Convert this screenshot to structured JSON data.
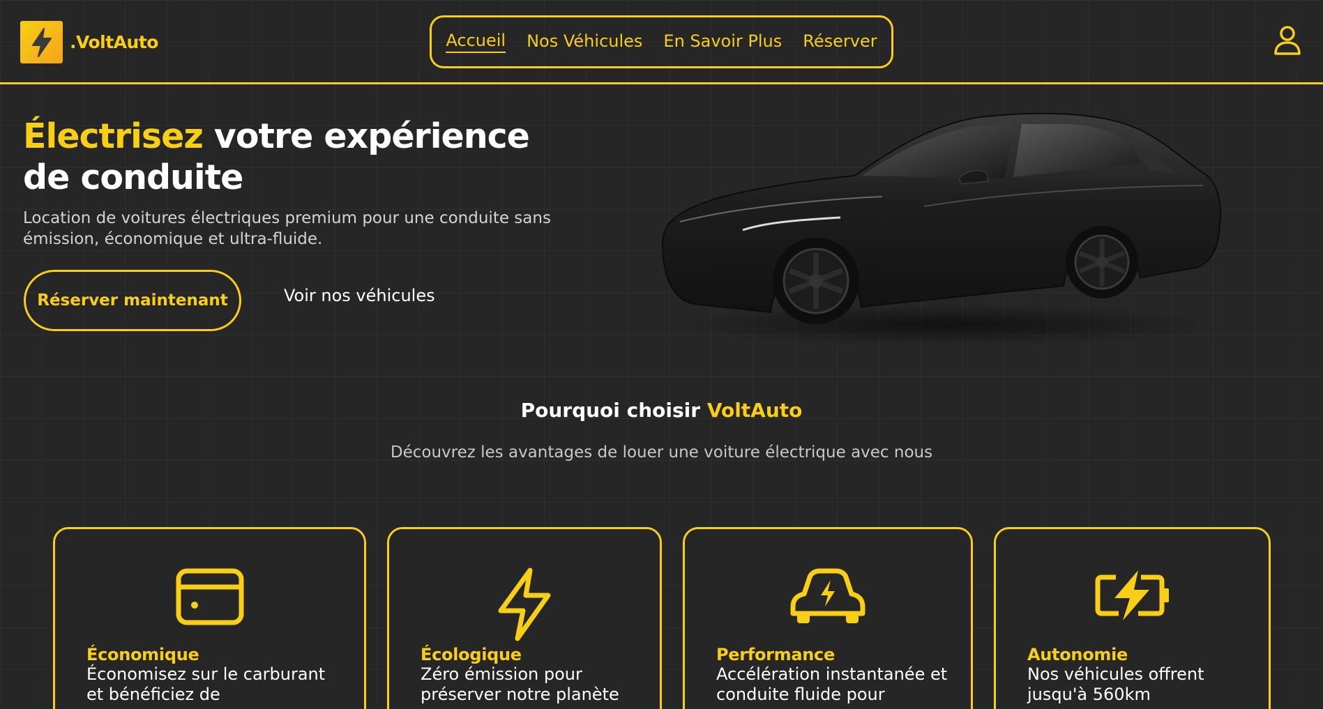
{
  "brand": {
    "name": ".VoltAuto"
  },
  "nav": {
    "items": [
      "Accueil",
      "Nos Véhicules",
      "En Savoir Plus",
      "Réserver"
    ],
    "active": "Accueil"
  },
  "hero": {
    "title_highlight": "Électrisez",
    "title_rest": " votre expérience de conduite",
    "subtitle": "Location de voitures électriques premium pour une conduite sans émission, économique et ultra-fluide.",
    "primary_cta": "Réserver maintenant",
    "secondary_cta": "Voir nos véhicules"
  },
  "why": {
    "title_prefix": "Pourquoi choisir ",
    "title_highlight": "VoltAuto",
    "subtitle": "Découvrez les avantages de louer une voiture électrique avec nous"
  },
  "features": [
    {
      "icon": "credit-card-icon",
      "title": "Économique",
      "text": "Économisez sur le carburant et bénéficiez de"
    },
    {
      "icon": "lightning-bolt-icon",
      "title": "Écologique",
      "text": "Zéro émission pour préserver notre planète"
    },
    {
      "icon": "electric-car-icon",
      "title": "Performance",
      "text": "Accélération instantanée et conduite fluide pour"
    },
    {
      "icon": "battery-charging-icon",
      "title": "Autonomie",
      "text": "Nos véhicules offrent jusqu'à 560km"
    }
  ],
  "colors": {
    "accent": "#f8cf16",
    "background": "#262626",
    "text": "#ffffff"
  }
}
